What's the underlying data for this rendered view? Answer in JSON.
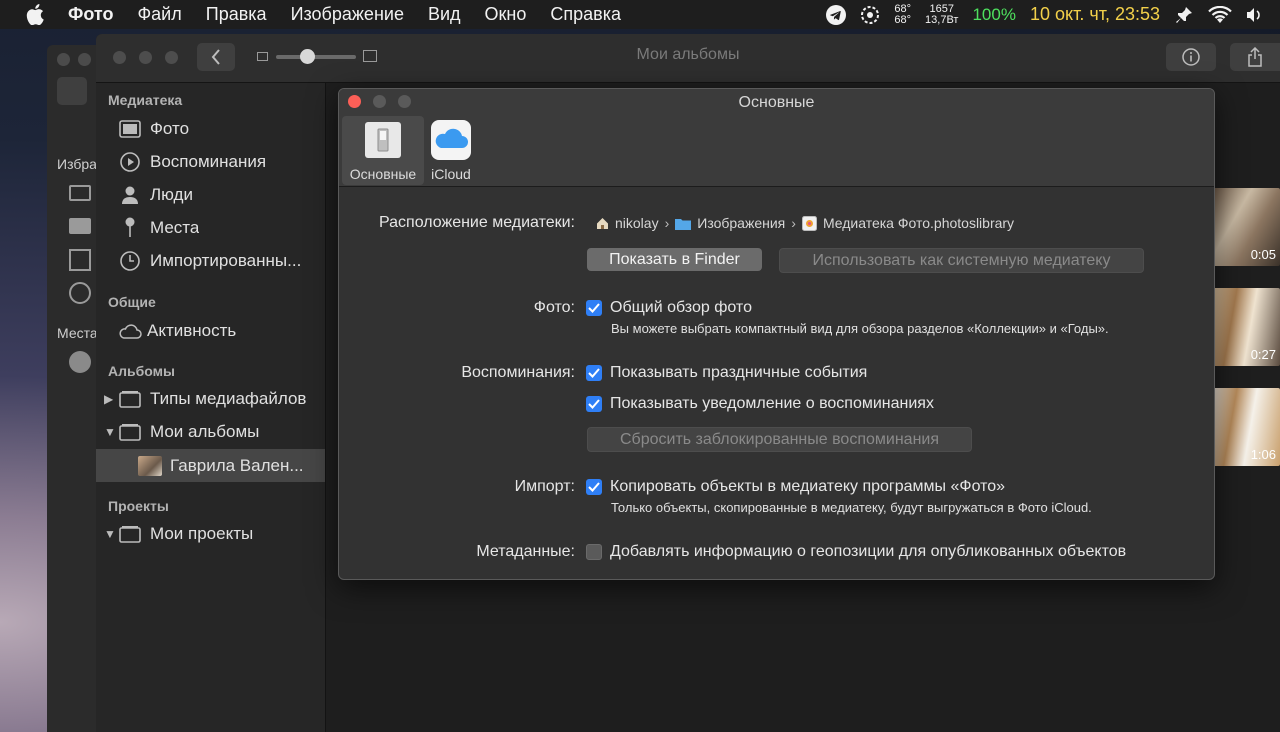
{
  "menubar": {
    "items": [
      "Фото",
      "Файл",
      "Правка",
      "Изображение",
      "Вид",
      "Окно",
      "Справка"
    ],
    "temp1": "68°",
    "temp2": "68°",
    "power1": "1657",
    "power2": "13,7Вт",
    "battery": "100%",
    "clock": "10 окт. чт, 23:53"
  },
  "backwin": {
    "label1": "Избра",
    "label2": "Места"
  },
  "window": {
    "title": "Мои альбомы"
  },
  "sidebar": {
    "library_header": "Медиатека",
    "library_items": [
      "Фото",
      "Воспоминания",
      "Люди",
      "Места",
      "Импортированны..."
    ],
    "shared_header": "Общие",
    "shared_items": [
      "Активность"
    ],
    "albums_header": "Альбомы",
    "album_items": [
      "Типы медиафайлов",
      "Мои альбомы",
      "Гаврила Вален..."
    ],
    "projects_header": "Проекты",
    "project_items": [
      "Мои проекты"
    ]
  },
  "thumbnails": [
    "0:05",
    "0:27",
    "1:06"
  ],
  "dialog": {
    "title": "Основные",
    "tabs": [
      "Основные",
      "iCloud"
    ],
    "location_label": "Расположение медиатеки:",
    "path": [
      "nikolay",
      "Изображения",
      "Медиатека Фото.photoslibrary"
    ],
    "show_in_finder": "Показать в Finder",
    "use_as_system": "Использовать как системную медиатеку",
    "photos_label": "Фото:",
    "photos_option": "Общий обзор фото",
    "photos_hint": "Вы можете выбрать компактный вид для обзора разделов «Коллекции» и «Годы».",
    "memories_label": "Воспоминания:",
    "memories_option1": "Показывать праздничные события",
    "memories_option2": "Показывать уведомление о воспоминаниях",
    "reset_blocked": "Сбросить заблокированные воспоминания",
    "import_label": "Импорт:",
    "import_option": "Копировать объекты в медиатеку программы «Фото»",
    "import_hint": "Только объекты, скопированные в медиатеку, будут выгружаться в Фото iCloud.",
    "metadata_label": "Метаданные:",
    "metadata_option": "Добавлять информацию о геопозиции для опубликованных объектов"
  },
  "colors": {
    "accent": "#2f7ff6",
    "close_red": "#fc5f57",
    "battery_green": "#4ee05e",
    "clock_yellow": "#f2d04a"
  }
}
